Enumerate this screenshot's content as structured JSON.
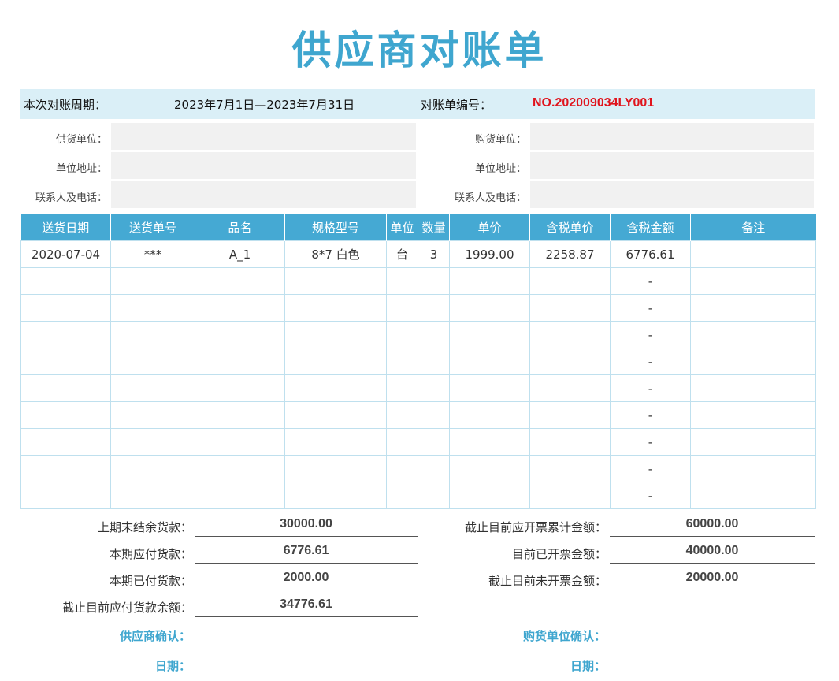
{
  "title": "供应商对账单",
  "period": {
    "label": "本次对账周期：",
    "value": "2023年7月1日—2023年7月31日",
    "no_label": "对账单编号：",
    "no_value": "NO.202009034LY001"
  },
  "supplier": {
    "unit_label": "供货单位：",
    "address_label": "单位地址：",
    "contact_label": "联系人及电话："
  },
  "buyer": {
    "unit_label": "购货单位：",
    "address_label": "单位地址：",
    "contact_label": "联系人及电话："
  },
  "table": {
    "headers": [
      "送货日期",
      "送货单号",
      "品名",
      "规格型号",
      "单位",
      "数量",
      "单价",
      "含税单价",
      "含税金额",
      "备注"
    ],
    "rows": [
      [
        "2020-07-04",
        "***",
        "A_1",
        "8*7 白色",
        "台",
        "3",
        "1999.00",
        "2258.87",
        "6776.61",
        ""
      ],
      [
        "",
        "",
        "",
        "",
        "",
        "",
        "",
        "",
        "-",
        ""
      ],
      [
        "",
        "",
        "",
        "",
        "",
        "",
        "",
        "",
        "-",
        ""
      ],
      [
        "",
        "",
        "",
        "",
        "",
        "",
        "",
        "",
        "-",
        ""
      ],
      [
        "",
        "",
        "",
        "",
        "",
        "",
        "",
        "",
        "-",
        ""
      ],
      [
        "",
        "",
        "",
        "",
        "",
        "",
        "",
        "",
        "-",
        ""
      ],
      [
        "",
        "",
        "",
        "",
        "",
        "",
        "",
        "",
        "-",
        ""
      ],
      [
        "",
        "",
        "",
        "",
        "",
        "",
        "",
        "",
        "-",
        ""
      ],
      [
        "",
        "",
        "",
        "",
        "",
        "",
        "",
        "",
        "-",
        ""
      ],
      [
        "",
        "",
        "",
        "",
        "",
        "",
        "",
        "",
        "-",
        ""
      ]
    ]
  },
  "summary": {
    "prev_balance_label": "上期末结余货款：",
    "prev_balance": "30000.00",
    "payable_label": "本期应付货款：",
    "payable": "6776.61",
    "paid_label": "本期已付货款：",
    "paid": "2000.00",
    "remaining_label": "截止目前应付货款余额：",
    "remaining": "34776.61",
    "invoice_total_label": "截止目前应开票累计金额：",
    "invoice_total": "60000.00",
    "invoiced_label": "目前已开票金额：",
    "invoiced": "40000.00",
    "uninvoiced_label": "截止目前未开票金额：",
    "uninvoiced": "20000.00"
  },
  "confirm": {
    "supplier_label": "供应商确认：",
    "supplier_date_label": "日期：",
    "buyer_label": "购货单位确认：",
    "buyer_date_label": "日期："
  }
}
